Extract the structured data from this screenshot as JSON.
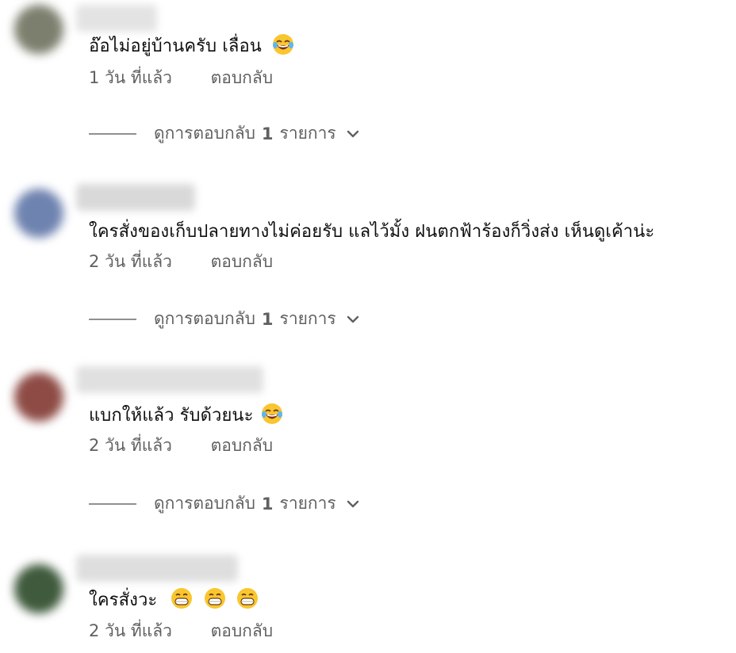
{
  "comments": [
    {
      "author": "",
      "text": "อ๊อไม่อยู่บ้านครับ เลื่อน",
      "emoji": [
        "face-with-tears-of-joy"
      ],
      "time": "1 วัน ที่แล้ว",
      "reply_label": "ตอบกลับ",
      "replies": {
        "prefix": "ดูการตอบกลับ",
        "count": "1",
        "suffix": "รายการ"
      },
      "colors": {
        "avatar": "#7d7f6e",
        "name_blur": "#e3e3e3"
      }
    },
    {
      "author": "",
      "text": "ใครสั่งของเก็บปลายทางไม่ค่อยรับ แลไว้มั้ง ฝนตกฟ้าร้องก็วิ่งส่ง เห็นดูเค้าน่ะ",
      "emoji": [],
      "time": "2 วัน ที่แล้ว",
      "reply_label": "ตอบกลับ",
      "replies": {
        "prefix": "ดูการตอบกลับ",
        "count": "1",
        "suffix": "รายการ"
      },
      "colors": {
        "avatar": "#6f83b0",
        "name_blur": "#d9d9d9"
      }
    },
    {
      "author": "",
      "text": "แบกให้แล้ว รับด้วยนะ",
      "emoji": [
        "face-with-tears-of-joy"
      ],
      "time": "2 วัน ที่แล้ว",
      "reply_label": "ตอบกลับ",
      "replies": {
        "prefix": "ดูการตอบกลับ",
        "count": "1",
        "suffix": "รายการ"
      },
      "colors": {
        "avatar": "#8e4b45",
        "name_blur": "#e0e0e0"
      }
    },
    {
      "author": "",
      "text": "ใครสั่งวะ",
      "emoji": [
        "grinning-face",
        "grinning-face",
        "grinning-face"
      ],
      "time": "2 วัน ที่แล้ว",
      "reply_label": "ตอบกลับ",
      "replies": null,
      "colors": {
        "avatar": "#3f5a3c",
        "name_blur": "#dedede"
      }
    }
  ],
  "colors": {
    "text": "#0f0f0f",
    "meta": "#606060",
    "emoji_face": "#f9c630"
  }
}
